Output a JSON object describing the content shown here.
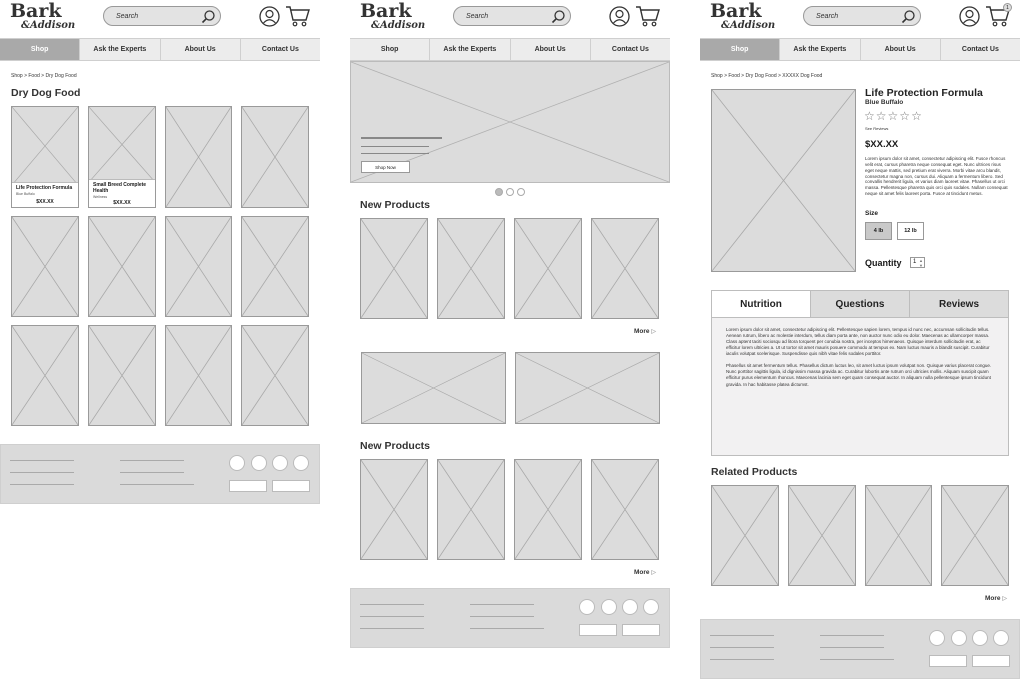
{
  "brand": {
    "line1": "Bark",
    "line2": "&Addison"
  },
  "search": {
    "placeholder": "Search"
  },
  "cart": {
    "count": "1"
  },
  "nav": {
    "items": [
      "Shop",
      "Ask the Experts",
      "About Us",
      "Contact Us"
    ]
  },
  "category_page": {
    "breadcrumb": "Shop > Food > Dry Dog Food",
    "title": "Dry Dog Food",
    "products": [
      {
        "name": "Life Protection Formula",
        "brand": "Blue Buffalo",
        "price": "$XX.XX"
      },
      {
        "name": "Small Breed Complete Health",
        "brand": "Wellness",
        "price": "$XX.XX"
      }
    ]
  },
  "home_page": {
    "hero": {
      "button": "Shop Now"
    },
    "carousel": {
      "slides": 3,
      "active": 0
    },
    "sections": [
      {
        "title": "New Products",
        "more": "More"
      },
      {
        "title": "New Products",
        "more": "More"
      }
    ]
  },
  "product_page": {
    "breadcrumb": "Shop > Food > Dry Dog Food > XXXXX Dog Food",
    "title": "Life Protection Formula",
    "brand": "Blue Buffalo",
    "rating": 0,
    "reviews_link": "See Reviews",
    "price": "$XX.XX",
    "description": "Lorem ipsum dolor sit amet, consectetur adipiscing elit. Fusce rhoncus velit erat, cursus pharetra neque consequat eget. Nunc ultrices risus eget neque mattis, sed pretium erat viverra. Morbi vitae arcu blandit, consectetur magna non, cursus dui. Aliquam a fermentum libero. Sed convallis hendrerit ligula, et varius diam laoreet vitae. Phasellus ut orci massa. Pellentesque pharetra quis orci quis sodales. Nullam consequat neque sit amet felis laoreet porta. Fusce at tincidunt metus.",
    "size_label": "Size",
    "sizes": [
      "4 lb",
      "12 lb"
    ],
    "quantity_label": "Quantity",
    "quantity": "1",
    "tabs": [
      "Nutrition",
      "Questions",
      "Reviews"
    ],
    "tab_content": [
      "Lorem ipsum dolor sit amet, consectetur adipiscing elit. Pellentesque sapien lorem, tempus id nunc nec, accumsan sollicitudin tellus. Aenean rutrum, libero ac molestie interdum, tellus diam porta ante, non auctor nunc odio eu dolor. Maecenas ac ullamcorper massa. Class aptent taciti sociosqu ad litora torquent per conubia nostra, per inceptos himenaeos. Quisque interdum sollicitudin erat, ac efficitur lorem ultricies a. Ut ut tortor sit amet mauris posuere commodo at tempus ex. Nam luctus mauris a blandit suscipit. Curabitur iaculis volutpat scelerisque. Suspendisse quis nibh vitae felis sodales porttitor.",
      "Phasellus sit amet fermentum tellus. Phasellus dictum luctus leo, sit amet luctus ipsum volutpat non. Quisque varius placerat congue. Nunc porttitor sagittis ligula, id dignissim massa gravida ac. Curabitur lobortis ante rutrum orci ultricies mollis. Aliquam suscipit quam efficitur purus elementum rhoncus. Maecenas lacinia sem eget quam consequat auctor. In aliquam nulla pellentesque ipsum tincidunt gravida. In hac habitasse platea dictumst."
    ],
    "related_title": "Related Products",
    "more": "More"
  }
}
